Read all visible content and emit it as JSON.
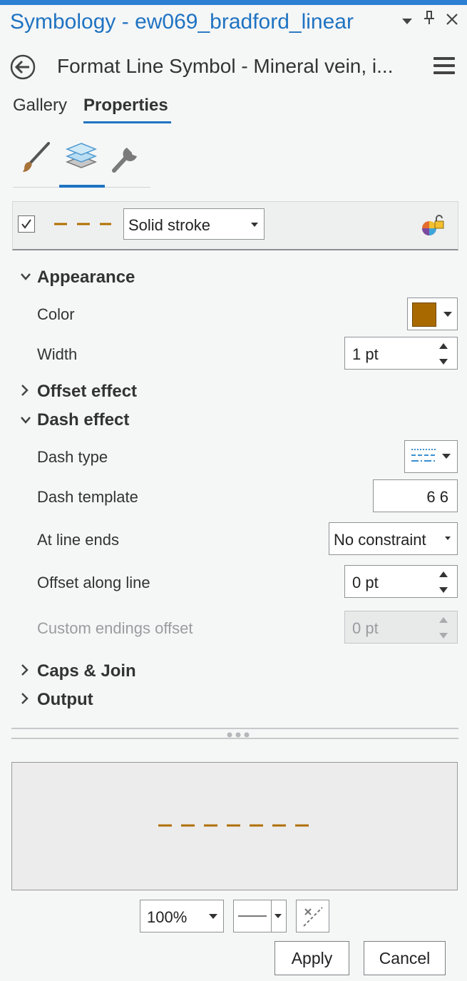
{
  "window": {
    "title": "Symbology - ew069_bradford_linear",
    "controls": {
      "menu": "▾",
      "pin": "⊥",
      "close": "✕"
    }
  },
  "header": {
    "subtitle": "Format Line Symbol - Mineral vein, i...",
    "back_icon": "back-arrow-icon",
    "menu_icon": "hamburger-menu-icon"
  },
  "tabs": [
    {
      "label": "Gallery",
      "active": false
    },
    {
      "label": "Properties",
      "active": true
    }
  ],
  "toolbar": {
    "tools": [
      "paintbrush-icon",
      "layers-icon",
      "wrench-icon"
    ],
    "selected_tool": "layers-icon"
  },
  "layer": {
    "checked": true,
    "stroke_type": "Solid stroke",
    "symbol_color": "#b06f00",
    "lock_icon": "color-lock-icon"
  },
  "appearance": {
    "heading": "Appearance",
    "expanded": true,
    "color_label": "Color",
    "color_value": "#a86a00",
    "width_label": "Width",
    "width_value": "1 pt"
  },
  "offset_effect": {
    "heading": "Offset effect",
    "expanded": false
  },
  "dash_effect": {
    "heading": "Dash effect",
    "expanded": true,
    "dash_type_label": "Dash type",
    "dash_template_label": "Dash template",
    "dash_template_value": "6 6",
    "line_ends_label": "At line ends",
    "line_ends_value": "No constraint",
    "offset_label": "Offset along line",
    "offset_value": "0 pt",
    "custom_offset_label": "Custom endings offset",
    "custom_offset_value": "0 pt"
  },
  "caps_join": {
    "heading": "Caps & Join",
    "expanded": false
  },
  "output": {
    "heading": "Output",
    "expanded": false
  },
  "preview": {
    "dash_color": "#b06f00"
  },
  "footer": {
    "zoom_value": "100%",
    "apply_label": "Apply",
    "cancel_label": "Cancel"
  }
}
